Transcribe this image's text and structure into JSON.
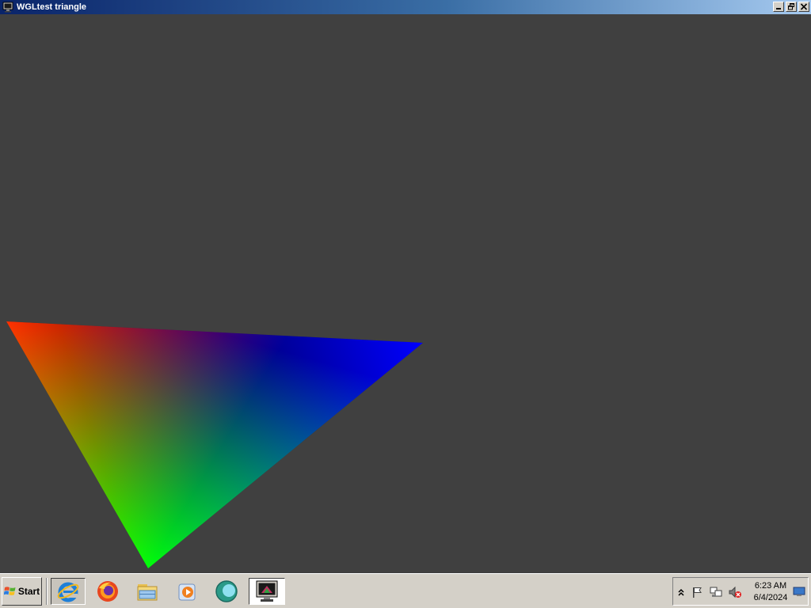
{
  "window": {
    "title": "WGLtest triangle",
    "icon": "monitor-icon",
    "buttons": {
      "minimize": "minimize-icon",
      "restore": "restore-icon",
      "close": "close-icon"
    }
  },
  "client": {
    "background": "#404040",
    "triangle": {
      "vertex_colors": [
        "#ff0000",
        "#0000ff",
        "#00ff00"
      ]
    }
  },
  "taskbar": {
    "start_label": "Start",
    "start_icon": "windows-flag-icon",
    "quick_launch": [
      {
        "name": "internet-explorer-icon"
      },
      {
        "name": "firefox-icon"
      },
      {
        "name": "file-explorer-icon"
      },
      {
        "name": "media-player-icon"
      },
      {
        "name": "app-bubble-icon"
      },
      {
        "name": "wgltest-window-icon"
      }
    ],
    "tray": {
      "icons": [
        "show-hidden-icon",
        "action-center-flag-icon",
        "network-icon",
        "volume-muted-icon"
      ],
      "time": "6:23 AM",
      "date": "6/4/2024",
      "show_desktop_icon": "show-desktop-icon"
    }
  }
}
